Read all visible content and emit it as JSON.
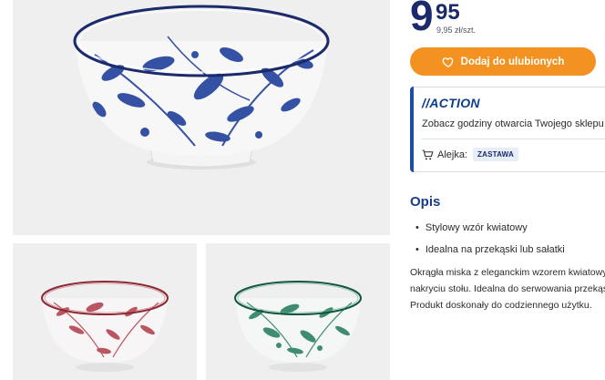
{
  "gallery": {
    "main_image": "blue floral bowl",
    "thumbnails": [
      "red floral bowl",
      "green floral bowl"
    ],
    "colors": {
      "background": "#efefef",
      "blue": "#1f3f9a",
      "red": "#b03a48",
      "green": "#1f7a5a"
    }
  },
  "price": {
    "integer": "9",
    "decimal": "95",
    "unit": "9,95 zł/szt."
  },
  "favorite_button": {
    "label": "Dodaj do ulubionych",
    "icon": "heart-icon",
    "color": "#f39221"
  },
  "store": {
    "brand": "//ACTION",
    "hours_link": "Zobacz godziny otwarcia Twojego sklepu",
    "aisle_label": "Alejka:",
    "aisle_value": "ZASTAWA",
    "aisle_icon": "cart-icon"
  },
  "description": {
    "title": "Opis",
    "bullets": [
      "Stylowy wzór kwiatowy",
      "Idealna na przekąski lub sałatki"
    ],
    "body_lines": [
      "Okrągła miska z eleganckim wzorem kwiatowym",
      "nakryciu stołu. Idealna do serwowania przekąsek",
      "Produkt doskonały do codziennego użytku."
    ]
  }
}
